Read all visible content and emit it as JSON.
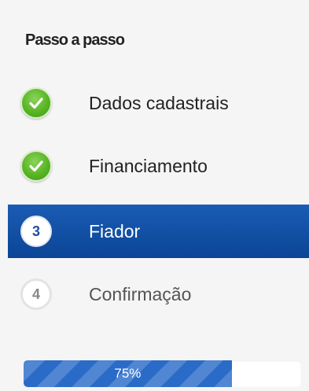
{
  "panel": {
    "title": "Passo a passo"
  },
  "steps": [
    {
      "number": "",
      "label": "Dados cadastrais",
      "status": "done",
      "icon": "check-icon"
    },
    {
      "number": "",
      "label": "Financiamento",
      "status": "done",
      "icon": "check-icon"
    },
    {
      "number": "3",
      "label": "Fiador",
      "status": "current",
      "icon": ""
    },
    {
      "number": "4",
      "label": "Confirmação",
      "status": "pending",
      "icon": ""
    }
  ],
  "progress": {
    "value": 0.75,
    "text": "75%"
  },
  "colors": {
    "active_step_bg": "#1555ad",
    "done_badge": "#58b524",
    "progress_fill": "#2a6bc8",
    "current_number": "#1e4e9e"
  }
}
